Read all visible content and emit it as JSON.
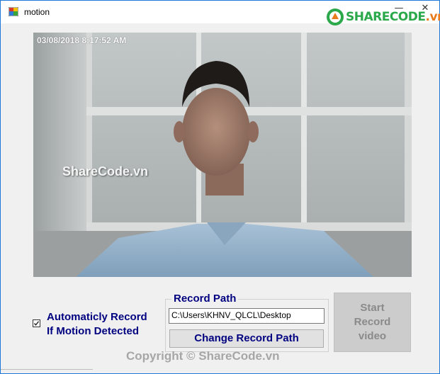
{
  "window": {
    "title": "motion",
    "minimize_glyph": "—",
    "close_glyph": "✕"
  },
  "brand": {
    "part1": "SHARECODE",
    "part2": ".vn"
  },
  "camera": {
    "timestamp": "03/08/2018 8:17:52 AM",
    "watermark": "ShareCode.vn"
  },
  "auto_record": {
    "checked": true,
    "label_line1": "Automaticly Record",
    "label_line2": "If Motion Detected"
  },
  "record_path": {
    "group_title": "Record Path",
    "path_value": "C:\\Users\\KHNV_QLCL\\Desktop",
    "change_button": "Change Record Path"
  },
  "start_button": {
    "line1": "Start",
    "line2": "Record",
    "line3": "video"
  },
  "footer": {
    "copyright": "Copyright © ShareCode.vn"
  },
  "colors": {
    "accent_text": "#000080",
    "window_border": "#1e78d7",
    "disabled_button": "#cccccc",
    "brand_green": "#2aa84a",
    "brand_orange": "#e87b1c"
  }
}
